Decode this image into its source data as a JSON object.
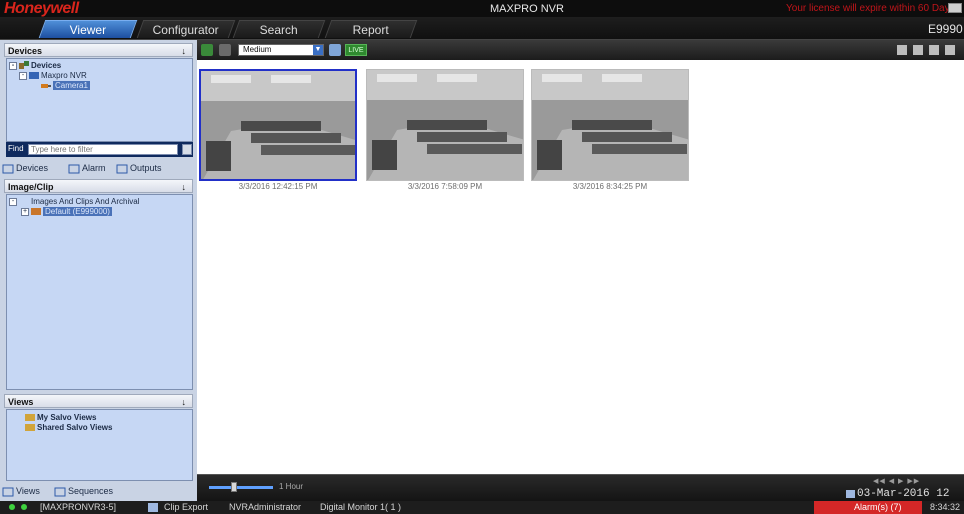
{
  "title_bar": {
    "logo": "Honeywell",
    "app_title": "MAXPRO NVR",
    "license_warning": "Your license will expire within  60 Day(s)"
  },
  "tabs": [
    {
      "label": "Viewer",
      "active": true
    },
    {
      "label": "Configurator",
      "active": false
    },
    {
      "label": "Search",
      "active": false
    },
    {
      "label": "Report",
      "active": false
    }
  ],
  "server_id": "E9990",
  "devices_panel": {
    "title": "Devices",
    "pin": "↓",
    "tree": {
      "root": "Devices",
      "nvr": "Maxpro NVR",
      "camera": "Camera1"
    },
    "find_label": "Find",
    "find_placeholder": "Type here to filter",
    "tabs": [
      "Devices",
      "Alarm",
      "Outputs"
    ]
  },
  "image_panel": {
    "title": "Image/Clip",
    "pin": "↓",
    "tree": {
      "root": "Images And Clips And Archival",
      "child": "Default (E999000)"
    }
  },
  "views_panel": {
    "title": "Views",
    "pin": "↓",
    "items": [
      "My Salvo Views",
      "Shared Salvo Views"
    ],
    "tabs": [
      "Views",
      "Sequences"
    ]
  },
  "toolbar": {
    "quality": "Medium",
    "live_label": "LIVE"
  },
  "thumbnails": [
    {
      "caption": "3/3/2016 12:42:15 PM",
      "selected": true
    },
    {
      "caption": "3/3/2016 7:58:09 PM",
      "selected": false
    },
    {
      "caption": "3/3/2016 8:34:25 PM",
      "selected": false
    }
  ],
  "timeline": {
    "slider_label": "1 Hour",
    "date": "03-Mar-2016 12"
  },
  "status_bar": {
    "server": "[MAXPRONVR3-5]",
    "clip_export": "Clip Export",
    "user": "NVRAdministrator",
    "monitor": "Digital Monitor 1( 1 )",
    "alarm": "Alarm(s) (7)",
    "time": "8:34:32"
  },
  "colors": {
    "accent": "#2f6fd0",
    "brand": "#d9251c",
    "alarm": "#d42727",
    "live": "#2f8a2f"
  }
}
